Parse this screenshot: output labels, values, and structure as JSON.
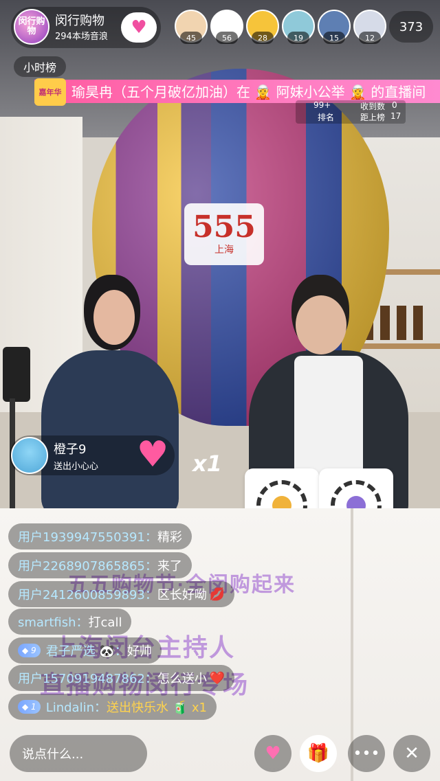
{
  "host": {
    "avatar_text": "闵行购物",
    "name": "闵行购物",
    "sound_wave": "294本场音浪"
  },
  "viewers": {
    "avatars": [
      {
        "badge": "45",
        "color": "#f1d4b0"
      },
      {
        "badge": "56",
        "color": "#ffffff"
      },
      {
        "badge": "28",
        "color": "#f6c43a"
      },
      {
        "badge": "19",
        "color": "#8fc9d9"
      },
      {
        "badge": "15",
        "color": "#5e7fb3"
      },
      {
        "badge": "12",
        "color": "#d6dbe8"
      }
    ],
    "total_count": "373"
  },
  "hourly_rank": {
    "label": "小时榜"
  },
  "banner": {
    "tag": "嘉年华",
    "text": "瑜昊冉（五个月破亿加油）在 🧝 阿妹小公举 🧝 的直播间"
  },
  "rank_overlay": {
    "badge": "99+",
    "rank_label": "排名",
    "received_label": "收到数",
    "received_value": "0",
    "distance_label": "距上榜",
    "distance_value": "17"
  },
  "gift": {
    "user": "橙子9",
    "desc": "送出小心心",
    "count": "x1"
  },
  "scene": {
    "logo_big": "555",
    "logo_sub": "上海",
    "desk_line1": "五五购物节·全闵购起来",
    "desk_line2": "上海闵台主持人",
    "desk_line3": "直播购物闵行专场"
  },
  "chat": [
    {
      "user": "用户1939947550391：",
      "msg": "精彩",
      "badge": "",
      "emoji": ""
    },
    {
      "user": "用户2268907865865：",
      "msg": "来了",
      "badge": "",
      "emoji": ""
    },
    {
      "user": "用户2412600859893：",
      "msg": "区长好呦",
      "badge": "",
      "emoji": "💋"
    },
    {
      "user": "smartfish：",
      "msg": "打call",
      "badge": "",
      "emoji": ""
    },
    {
      "user": "君子严选 🐼：",
      "msg": "好帅",
      "badge": "9",
      "emoji": ""
    },
    {
      "user": "用户1570919487862：",
      "msg": "怎么送小",
      "badge": "",
      "emoji": "❤️"
    },
    {
      "user": "Lindalin：",
      "msg": "送出快乐水 🧃 x1",
      "badge": "1",
      "emoji": ""
    }
  ],
  "bottom": {
    "input_placeholder": "说点什么...",
    "like_icon": "heart-icon",
    "gift_icon": "gift-icon",
    "more_icon": "more-icon",
    "close_icon": "close-icon"
  }
}
